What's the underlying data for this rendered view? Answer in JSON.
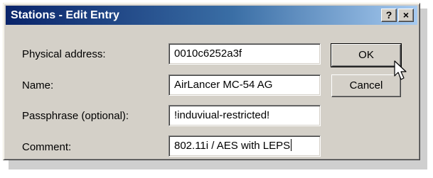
{
  "window": {
    "title": "Stations - Edit Entry",
    "help_label": "?",
    "close_label": "×"
  },
  "form": {
    "fields": [
      {
        "label": "Physical address:",
        "value": "0010c6252a3f"
      },
      {
        "label": "Name:",
        "value": "AirLancer MC-54 AG"
      },
      {
        "label": "Passphrase (optional):",
        "value": "!induviual-restricted!"
      },
      {
        "label": "Comment:",
        "value": "802.11i / AES with LEPS"
      }
    ]
  },
  "buttons": {
    "ok_label": "OK",
    "cancel_label": "Cancel"
  },
  "colors": {
    "titlebar_start": "#0a246a",
    "titlebar_end": "#a6caf0",
    "dialog_face": "#d4d0c8"
  },
  "icons": {
    "cursor": "arrow-cursor-icon"
  }
}
